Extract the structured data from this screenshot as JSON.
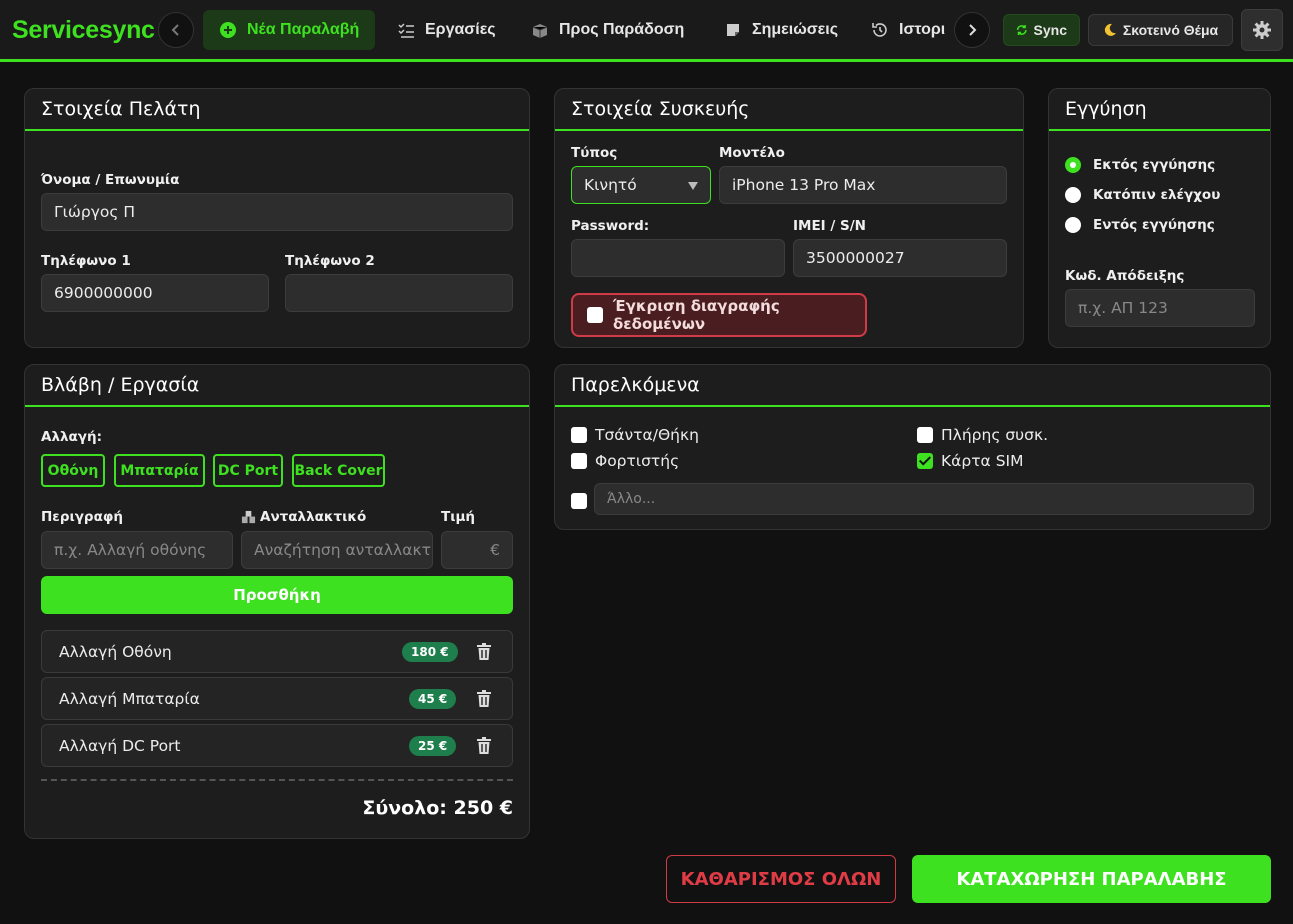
{
  "nav": {
    "brand": "Servicesync",
    "tabs": [
      {
        "label": "Νέα Παραλαβή",
        "icon": "plus-circle-icon"
      },
      {
        "label": "Εργασίες",
        "icon": "checklist-icon"
      },
      {
        "label": "Προς Παράδοση",
        "icon": "box-icon"
      },
      {
        "label": "Σημειώσεις",
        "icon": "note-icon"
      },
      {
        "label": "Ιστορι",
        "icon": "history-icon"
      }
    ],
    "sync_label": "Sync",
    "theme_label": "Σκοτεινό Θέμα"
  },
  "customer": {
    "title": "Στοιχεία Πελάτη",
    "name_label": "Όνομα / Επωνυμία",
    "name_value": "Γιώργος Π",
    "phone1_label": "Τηλέφωνο 1",
    "phone1_value": "6900000000",
    "phone2_label": "Τηλέφωνο 2",
    "phone2_value": ""
  },
  "device": {
    "title": "Στοιχεία Συσκευής",
    "type_label": "Τύπος",
    "type_value": "Κινητό",
    "model_label": "Μοντέλο",
    "model_value": "iPhone 13 Pro Max",
    "password_label": "Password:",
    "password_value": "",
    "imei_label": "IMEI / S/N",
    "imei_value": "3500000027",
    "consent_label": "Έγκριση διαγραφής δεδομένων",
    "consent_checked": false
  },
  "warranty": {
    "title": "Εγγύηση",
    "options": [
      {
        "label": "Εκτός εγγύησης",
        "selected": true
      },
      {
        "label": "Κατόπιν ελέγχου",
        "selected": false
      },
      {
        "label": "Εντός εγγύησης",
        "selected": false
      }
    ],
    "receipt_label": "Κωδ. Απόδειξης",
    "receipt_placeholder": "π.χ. ΑΠ 123"
  },
  "job": {
    "title": "Βλάβη / Εργασία",
    "change_label": "Αλλαγή:",
    "chips": [
      "Οθόνη",
      "Μπαταρία",
      "DC Port",
      "Back Cover"
    ],
    "desc_label": "Περιγραφή",
    "desc_placeholder": "π.χ. Αλλαγή οθόνης",
    "part_label": "Ανταλλακτικό",
    "part_placeholder": "Αναζήτηση ανταλλακτι",
    "price_label": "Τιμή",
    "price_suffix": "€",
    "add_label": "Προσθήκη",
    "items": [
      {
        "name": "Αλλαγή Οθόνη",
        "price": "180 €"
      },
      {
        "name": "Αλλαγή Μπαταρία",
        "price": "45 €"
      },
      {
        "name": "Αλλαγή DC Port",
        "price": "25 €"
      }
    ],
    "total": "Σύνολο: 250 €"
  },
  "accessories": {
    "title": "Παρελκόμενα",
    "items": [
      {
        "label": "Τσάντα/Θήκη",
        "checked": false
      },
      {
        "label": "Πλήρης συσκ.",
        "checked": true
      },
      {
        "label": "Φορτιστής",
        "checked": false
      },
      {
        "label": "Κάρτα SIM",
        "checked": true
      }
    ],
    "other_placeholder": "Άλλο..."
  },
  "actions": {
    "clear_label": "ΚΑΘΑΡΙΣΜΟΣ ΟΛΩΝ",
    "save_label": "ΚΑΤΑΧΩΡΗΣΗ ΠΑΡΑΛΑΒΗΣ"
  },
  "colors": {
    "accent": "#3ee11f",
    "danger": "#d03a44",
    "badge": "#1e7f4c"
  }
}
